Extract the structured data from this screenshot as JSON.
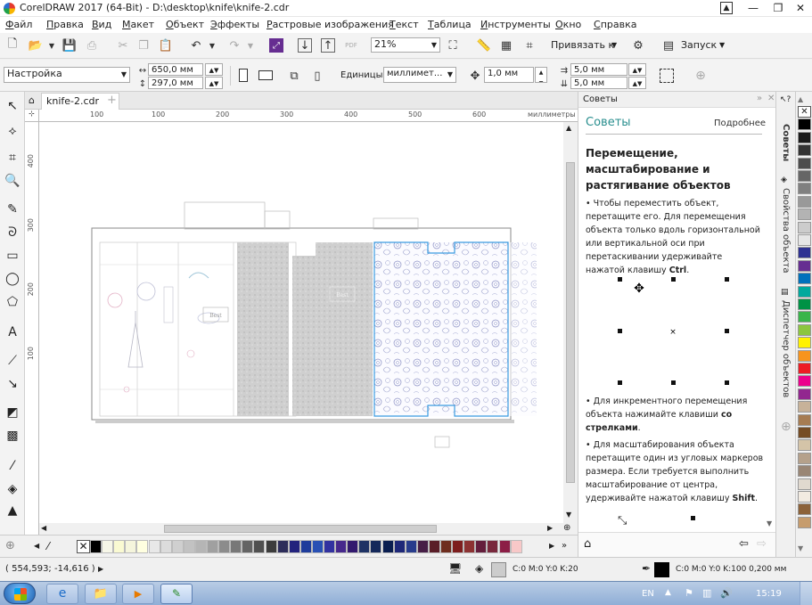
{
  "window": {
    "title": "CorelDRAW 2017 (64-Bit) - D:\\desktop\\knife\\knife-2.cdr",
    "controls": [
      "—",
      "❐",
      "✕"
    ]
  },
  "menu": [
    "Файл",
    "Правка",
    "Вид",
    "Макет",
    "Объект",
    "Эффекты",
    "Растровые изображения",
    "Текст",
    "Таблица",
    "Инструменты",
    "Окно",
    "Справка"
  ],
  "toolbar": {
    "zoom": "21%",
    "snap_label": "Привязать к",
    "launch_label": "Запуск"
  },
  "propertybar": {
    "preset": "Настройка",
    "width": "650,0 мм",
    "height": "297,0 мм",
    "units_label": "Единицы:",
    "units_value": "миллимет...",
    "nudge": "1,0 мм",
    "dup_x": "5,0 мм",
    "dup_y": "5,0 мм"
  },
  "document": {
    "tab_label": "knife-2.cdr"
  },
  "ruler": {
    "h_labels": [
      "100",
      "100",
      "200",
      "300",
      "400",
      "500",
      "600"
    ],
    "units": "миллиметры",
    "v_labels": [
      "400",
      "300",
      "200",
      "100"
    ]
  },
  "canvas": {
    "labels": [
      "Best",
      "Best"
    ]
  },
  "docker": {
    "header": "Советы",
    "title": "Советы",
    "more_link": "Подробнее",
    "heading": "Перемещение, масштабирование и растягивание объектов",
    "tip1_text": "Чтобы переместить объект, перетащите его. Для перемещения объекта только вдоль горизонтальной или вертикальной оси при перетаскивании удерживайте нажатой клавишу",
    "tip1_key": "Ctrl",
    "tip2_text": "Для инкрементного перемещения объекта нажимайте клавиши",
    "tip2_key": "со стрелками",
    "tip3_text": "Для масштабирования объекта перетащите один из угловых маркеров размера. Если требуется выполнить масштабирование от центра, удерживайте нажатой клавишу",
    "tip3_key": "Shift"
  },
  "docker_tabs": [
    "Советы",
    "Свойства объекта",
    "Диспетчер объектов"
  ],
  "palette_v": [
    "#ffffff",
    "#000000",
    "#1a1a1a",
    "#333333",
    "#4d4d4d",
    "#666666",
    "#808080",
    "#999999",
    "#b3b3b3",
    "#cccccc",
    "#e6e6e6",
    "#2e3192",
    "#662d91",
    "#0071bc",
    "#00a99d",
    "#009245",
    "#39b54a",
    "#8cc63f",
    "#fff200",
    "#f7941d",
    "#ed1c24",
    "#ec008c",
    "#92278f",
    "#c7b299",
    "#a67c52",
    "#754c24",
    "#d4c4a8",
    "#b5a18b",
    "#998675",
    "#e0d9cf",
    "#f2ebe1",
    "#8c6239",
    "#c69c6d"
  ],
  "palette_h": [
    "#000000",
    "#f7f7e8",
    "#fafad2",
    "#f5f5dc",
    "#ffffe0",
    "#e8e8e8",
    "#dcdcdc",
    "#cfcfcf",
    "#c2c2c2",
    "#b5b5b5",
    "#a0a0a0",
    "#8c8c8c",
    "#787878",
    "#646464",
    "#505050",
    "#3c3c3c",
    "#2d2d5a",
    "#23237d",
    "#1e3c9b",
    "#2850b4",
    "#3232a0",
    "#46288c",
    "#32196e",
    "#1e3264",
    "#14285a",
    "#0a1e50",
    "#1e2878",
    "#283c8c",
    "#461e46",
    "#5a1e28",
    "#6e2d1e",
    "#7d1e1e",
    "#8c3232",
    "#641e3c",
    "#78283c",
    "#8c1e46",
    "#f8c8c8"
  ],
  "status": {
    "coords": "( 554,593; -14,616 )",
    "fill": "C:0 M:0 Y:0 K:20",
    "outline": "C:0 M:0 Y:0 K:100  0,200 мм"
  },
  "taskbar": {
    "lang": "EN",
    "time": "15:19"
  }
}
